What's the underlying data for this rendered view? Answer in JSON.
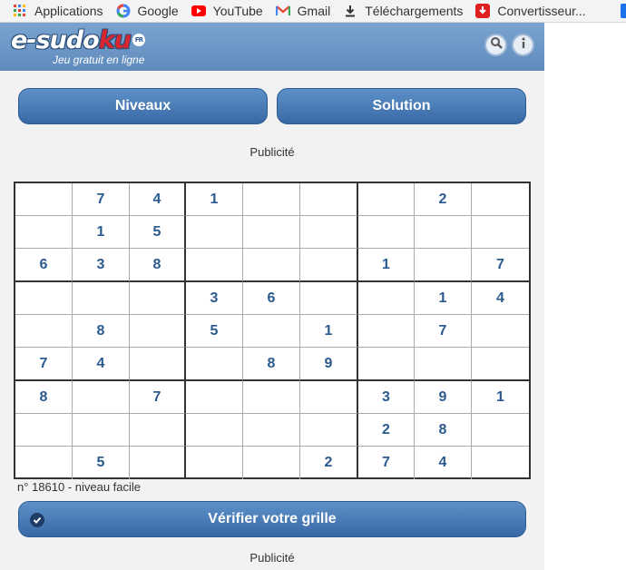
{
  "bookmarks": [
    {
      "label": "Applications",
      "icon": "apps-grid-icon"
    },
    {
      "label": "Google",
      "icon": "google-icon"
    },
    {
      "label": "YouTube",
      "icon": "youtube-icon"
    },
    {
      "label": "Gmail",
      "icon": "gmail-icon"
    },
    {
      "label": "Téléchargements",
      "icon": "download-icon"
    },
    {
      "label": "Convertisseur...",
      "icon": "convert-icon"
    }
  ],
  "header": {
    "logo_text_start": "e-sudo",
    "logo_text_red": "ku",
    "logo_suffix": "FR",
    "tagline": "Jeu gratuit en ligne",
    "colors": {
      "header_top": "#7aa3d0",
      "header_bottom": "#5f8bbd",
      "logo_red": "#d8262f"
    }
  },
  "buttons": {
    "levels": "Niveaux",
    "solution": "Solution"
  },
  "ads": {
    "top": "Publicité",
    "bottom": "Publicité"
  },
  "grid": {
    "rows": [
      [
        "",
        "7",
        "4",
        "1",
        "",
        "",
        "",
        "2",
        ""
      ],
      [
        "",
        "1",
        "5",
        "",
        "",
        "",
        "",
        "",
        ""
      ],
      [
        "6",
        "3",
        "8",
        "",
        "",
        "",
        "1",
        "",
        "7"
      ],
      [
        "",
        "",
        "",
        "3",
        "6",
        "",
        "",
        "1",
        "4"
      ],
      [
        "",
        "8",
        "",
        "5",
        "",
        "1",
        "",
        "7",
        ""
      ],
      [
        "7",
        "4",
        "",
        "",
        "8",
        "9",
        "",
        "",
        ""
      ],
      [
        "8",
        "",
        "7",
        "",
        "",
        "",
        "3",
        "9",
        "1"
      ],
      [
        "",
        "",
        "",
        "",
        "",
        "",
        "2",
        "8",
        ""
      ],
      [
        "",
        "5",
        "",
        "",
        "",
        "2",
        "7",
        "4",
        ""
      ]
    ],
    "digit_color": "#2b5a8f"
  },
  "puzzle_info": "n° 18610 - niveau facile",
  "verify_button": "Vérifier votre grille"
}
